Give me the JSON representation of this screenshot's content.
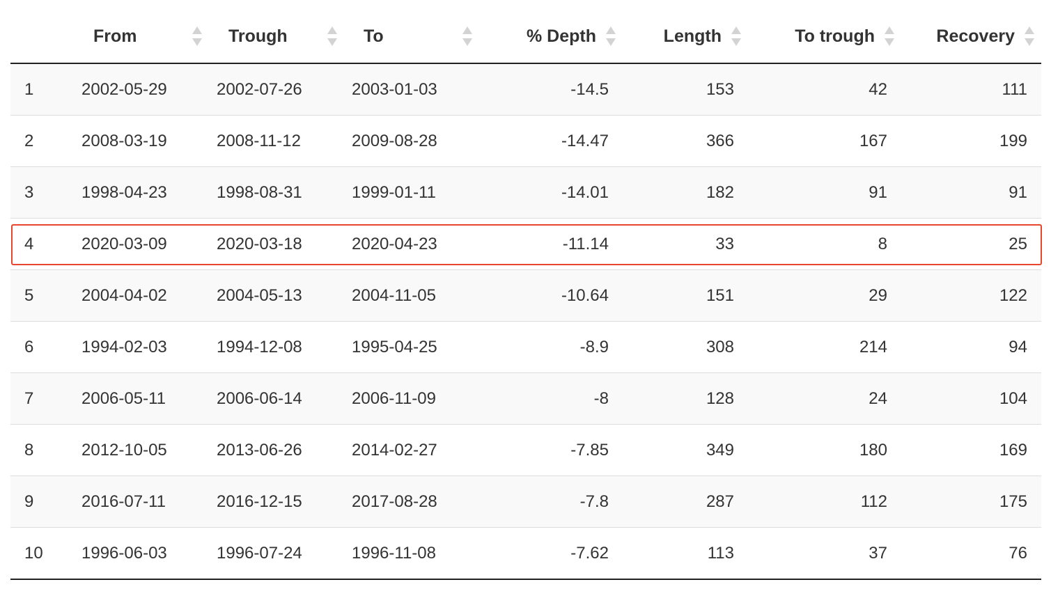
{
  "table": {
    "columns": [
      {
        "label": "",
        "align": "left",
        "sortable": false
      },
      {
        "label": "From",
        "align": "left",
        "sortable": true
      },
      {
        "label": "Trough",
        "align": "left",
        "sortable": true
      },
      {
        "label": "To",
        "align": "left",
        "sortable": true
      },
      {
        "label": "% Depth",
        "align": "right",
        "sortable": true
      },
      {
        "label": "Length",
        "align": "right",
        "sortable": true
      },
      {
        "label": "To trough",
        "align": "right",
        "sortable": true
      },
      {
        "label": "Recovery",
        "align": "right",
        "sortable": true
      }
    ],
    "rows": [
      [
        "1",
        "2002-05-29",
        "2002-07-26",
        "2003-01-03",
        "-14.5",
        "153",
        "42",
        "111"
      ],
      [
        "2",
        "2008-03-19",
        "2008-11-12",
        "2009-08-28",
        "-14.47",
        "366",
        "167",
        "199"
      ],
      [
        "3",
        "1998-04-23",
        "1998-08-31",
        "1999-01-11",
        "-14.01",
        "182",
        "91",
        "91"
      ],
      [
        "4",
        "2020-03-09",
        "2020-03-18",
        "2020-04-23",
        "-11.14",
        "33",
        "8",
        "25"
      ],
      [
        "5",
        "2004-04-02",
        "2004-05-13",
        "2004-11-05",
        "-10.64",
        "151",
        "29",
        "122"
      ],
      [
        "6",
        "1994-02-03",
        "1994-12-08",
        "1995-04-25",
        "-8.9",
        "308",
        "214",
        "94"
      ],
      [
        "7",
        "2006-05-11",
        "2006-06-14",
        "2006-11-09",
        "-8",
        "128",
        "24",
        "104"
      ],
      [
        "8",
        "2012-10-05",
        "2013-06-26",
        "2014-02-27",
        "-7.85",
        "349",
        "180",
        "169"
      ],
      [
        "9",
        "2016-07-11",
        "2016-12-15",
        "2017-08-28",
        "-7.8",
        "287",
        "112",
        "175"
      ],
      [
        "10",
        "1996-06-03",
        "1996-07-24",
        "1996-11-08",
        "-7.62",
        "113",
        "37",
        "76"
      ]
    ],
    "highlighted_row": 4,
    "highlight_color": "#e8452c"
  }
}
